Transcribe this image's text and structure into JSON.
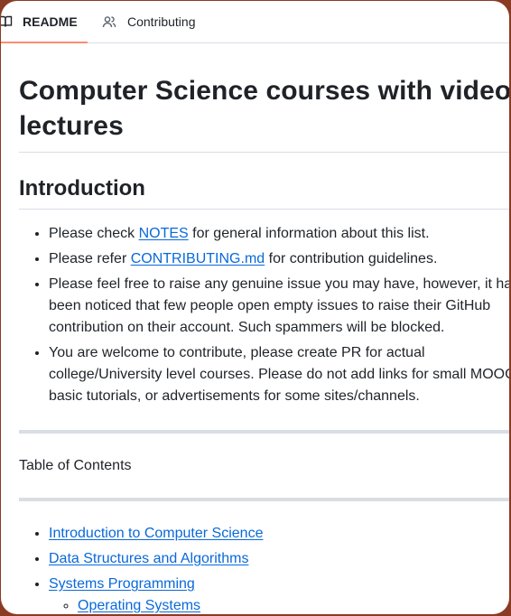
{
  "tabs": [
    {
      "label": "README",
      "icon": "book-icon",
      "active": true
    },
    {
      "label": "Contributing",
      "icon": "people-icon",
      "active": false
    }
  ],
  "title": "Computer Science courses with video lectures",
  "introduction": {
    "heading": "Introduction",
    "items": [
      {
        "before": "Please check ",
        "link": "NOTES",
        "after": " for general information about this list."
      },
      {
        "before": "Please refer ",
        "link": "CONTRIBUTING.md",
        "after": " for contribution guidelines."
      },
      {
        "lines": [
          "Please feel free to raise any genuine issue you may have, however, it ha",
          "been noticed that few people open empty issues to raise their GitHub",
          "contribution on their account. Such spammers will be blocked."
        ]
      },
      {
        "lines": [
          "You are welcome to contribute, please create PR for actual",
          "college/University level courses. Please do not add links for small MOOC",
          "basic tutorials, or advertisements for some sites/channels."
        ]
      }
    ]
  },
  "toc": {
    "heading": "Table of Contents",
    "items": [
      "Introduction to Computer Science",
      "Data Structures and Algorithms",
      "Systems Programming"
    ],
    "subitems": [
      "Operating Systems"
    ]
  },
  "colors": {
    "link": "#0969da",
    "active_tab_underline": "#fd8c73",
    "rule": "#d8dee4",
    "outer_background": "#8a3b24"
  }
}
